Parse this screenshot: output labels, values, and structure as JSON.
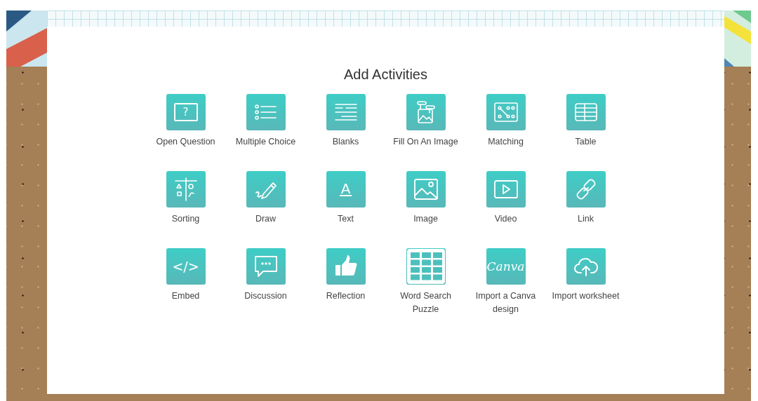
{
  "title": "Add Activities",
  "activities": [
    {
      "label": "Open Question",
      "kind": "question",
      "icon_text": "?"
    },
    {
      "label": "Multiple Choice",
      "kind": "list"
    },
    {
      "label": "Blanks",
      "kind": "blanks"
    },
    {
      "label": "Fill On An Image",
      "kind": "fillimage"
    },
    {
      "label": "Matching",
      "kind": "matching"
    },
    {
      "label": "Table",
      "kind": "table"
    },
    {
      "label": "Sorting",
      "kind": "sorting"
    },
    {
      "label": "Draw",
      "kind": "draw"
    },
    {
      "label": "Text",
      "kind": "text",
      "icon_text": "A"
    },
    {
      "label": "Image",
      "kind": "image"
    },
    {
      "label": "Video",
      "kind": "video"
    },
    {
      "label": "Link",
      "kind": "link"
    },
    {
      "label": "Embed",
      "kind": "code",
      "icon_text": "</>"
    },
    {
      "label": "Discussion",
      "kind": "chat"
    },
    {
      "label": "Reflection",
      "kind": "thumb"
    },
    {
      "label": "Word Search Puzzle",
      "kind": "grid"
    },
    {
      "label": "Import a Canva design",
      "kind": "logo",
      "icon_text": "Canva"
    },
    {
      "label": "Import worksheet",
      "kind": "upload"
    }
  ]
}
